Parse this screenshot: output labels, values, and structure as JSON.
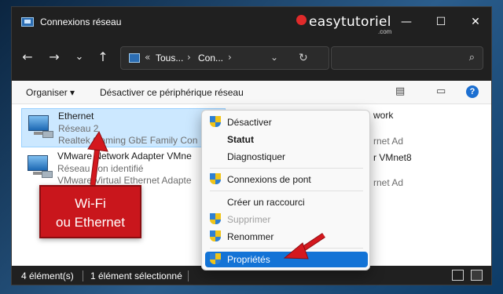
{
  "window": {
    "title": "Connexions réseau",
    "brand": "easytutoriel",
    "brand_suffix": ".com",
    "controls": {
      "minimize": "—",
      "maximize": "☐",
      "close": "✕"
    }
  },
  "nav": {
    "back_icon": "←",
    "forward_icon": "→",
    "history_icon": "⌄",
    "up_icon": "↑",
    "address": {
      "prefix": "«",
      "crumb1": "Tous...",
      "sep": "›",
      "crumb2": "Con...",
      "dropdown": "⌄",
      "refresh": "↻"
    },
    "search_icon": "⌕"
  },
  "toolbar": {
    "organize": "Organiser ▾",
    "disable_device": "Désactiver ce périphérique réseau",
    "view_icon": "▤",
    "pane_icon": "▭",
    "help": "?"
  },
  "items": [
    {
      "name": "Ethernet",
      "status": "Réseau 2",
      "device": "Realtek Gaming GbE Family Con"
    },
    {
      "name": "VMware Network Adapter VMne",
      "status": "Réseau non identifié",
      "device": "VMware Virtual Ethernet Adapte"
    }
  ],
  "right_column": {
    "r1": "work",
    "r2": "rnet Ad",
    "r3": "r VMnet8",
    "r4": "rnet Ad"
  },
  "context_menu": [
    {
      "label": "Désactiver",
      "icon": "shield-icon"
    },
    {
      "label": "Statut",
      "bold": true
    },
    {
      "label": "Diagnostiquer"
    },
    {
      "label": "Connexions de pont",
      "icon": "shield-icon"
    },
    {
      "label": "Créer un raccourci"
    },
    {
      "label": "Supprimer",
      "icon": "shield-icon",
      "disabled": true
    },
    {
      "label": "Renommer",
      "icon": "shield-icon"
    },
    {
      "label": "Propriétés",
      "icon": "shield-icon",
      "highlighted": true
    }
  ],
  "callout": {
    "line1": "Wi-Fi",
    "line2": "ou Ethernet"
  },
  "status": {
    "count": "4 élément(s)",
    "selected": "1 élément sélectionné"
  },
  "colors": {
    "callout_red": "#c9161c",
    "highlight": "#1373d6",
    "selection": "#cce8ff"
  }
}
